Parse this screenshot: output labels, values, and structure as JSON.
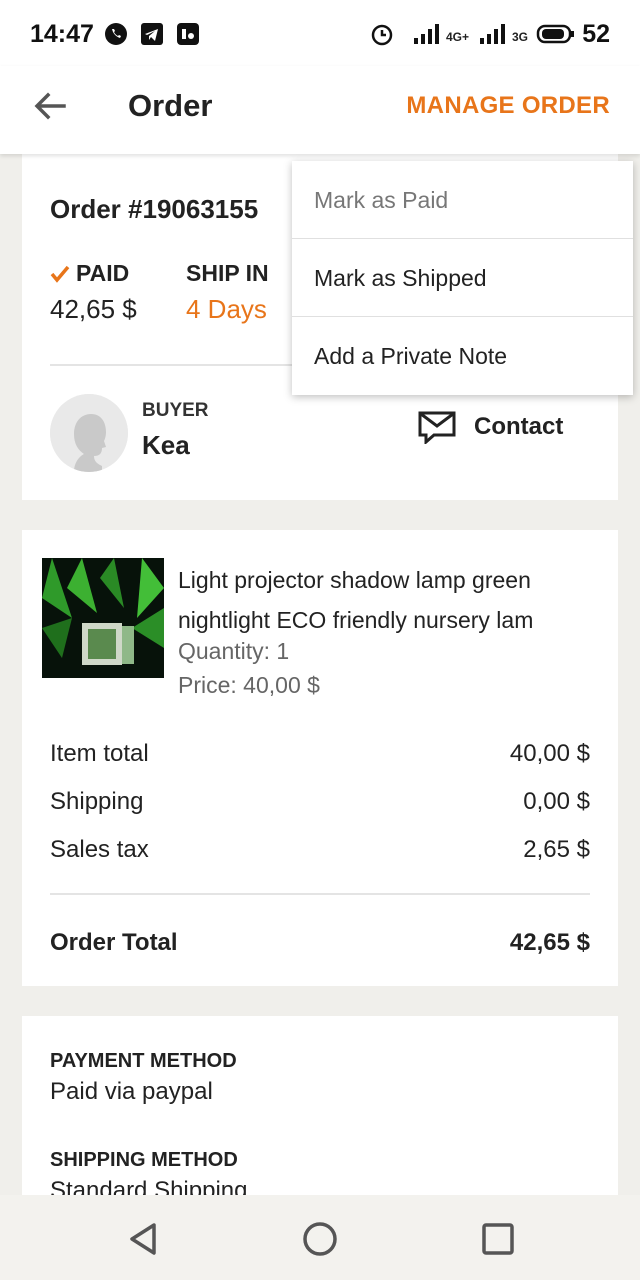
{
  "status_bar": {
    "time": "14:47",
    "battery": "52",
    "network_1": "4G+",
    "network_2": "3G",
    "icons": [
      "whatsapp-icon",
      "telegram-icon",
      "app-icon",
      "alarm-icon",
      "signal-icon",
      "battery-icon"
    ]
  },
  "app_bar": {
    "title": "Order",
    "manage_label": "MANAGE ORDER"
  },
  "order": {
    "number": "Order #19063155",
    "paid_label": "PAID",
    "paid_value": "42,65 $",
    "ship_label": "SHIP IN",
    "ship_value": "4 Days"
  },
  "buyer": {
    "label": "BUYER",
    "name": "Kea",
    "contact_label": "Contact"
  },
  "product": {
    "title_line1": "Light projector shadow lamp green",
    "title_line2": "nightlight ECO friendly nursery lam",
    "quantity": "Quantity: 1",
    "price": "Price: 40,00 $"
  },
  "totals": {
    "item_total_label": "Item total",
    "item_total_value": "40,00 $",
    "shipping_label": "Shipping",
    "shipping_value": "0,00 $",
    "tax_label": "Sales tax",
    "tax_value": "2,65 $",
    "order_total_label": "Order Total",
    "order_total_value": "42,65 $"
  },
  "payment": {
    "label": "PAYMENT METHOD",
    "value": "Paid via paypal"
  },
  "shipping_method": {
    "label": "SHIPPING METHOD",
    "value": "Standard Shipping"
  },
  "menu": {
    "items": [
      "Mark as Paid",
      "Mark as Shipped",
      "Add a Private Note"
    ]
  },
  "colors": {
    "accent": "#e8751a",
    "background": "#f0efeb"
  }
}
